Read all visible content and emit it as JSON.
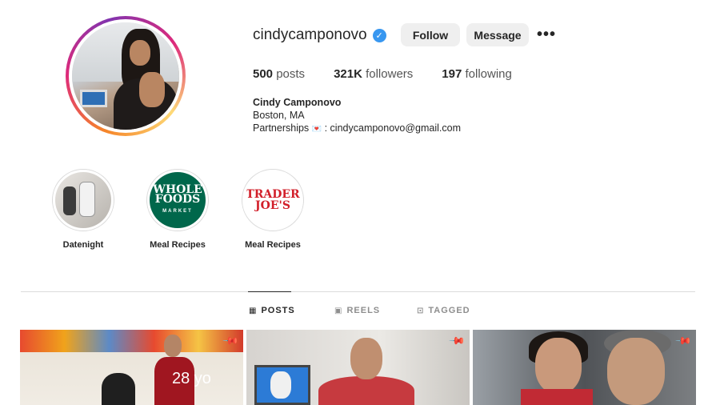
{
  "profile": {
    "username": "cindycamponovo",
    "verified_icon": "verified-badge-icon",
    "follow_label": "Follow",
    "message_label": "Message",
    "more_label": "•••"
  },
  "stats": {
    "posts_count": "500",
    "posts_label": "posts",
    "followers_count": "321K",
    "followers_label": "followers",
    "following_count": "197",
    "following_label": "following"
  },
  "bio": {
    "name": "Cindy Camponovo",
    "location": "Boston, MA",
    "partnerships_label": "Partnerships",
    "partnerships_emoji": "💌",
    "email": ": cindycamponovo@gmail.com"
  },
  "highlights": [
    {
      "label": "Datenight"
    },
    {
      "label": "Meal Recipes",
      "logo_line1": "WHOLE",
      "logo_line2": "FOODS",
      "logo_line3": "MARKET"
    },
    {
      "label": "Meal Recipes",
      "logo_line1": "TRADER",
      "logo_line2": "JOE'S"
    }
  ],
  "tabs": [
    {
      "label": "POSTS",
      "icon": "grid-icon",
      "active": true
    },
    {
      "label": "REELS",
      "icon": "reels-icon",
      "active": false
    },
    {
      "label": "TAGGED",
      "icon": "tagged-icon",
      "active": false
    }
  ],
  "posts": [
    {
      "caption": "28 yo",
      "pinned": true
    },
    {
      "pinned": true
    },
    {
      "pinned": true
    }
  ],
  "colors": {
    "accent": "#3897f0",
    "button_bg": "#efefef",
    "whole_foods_green": "#00674b",
    "trader_joes_red": "#d21f2a"
  }
}
